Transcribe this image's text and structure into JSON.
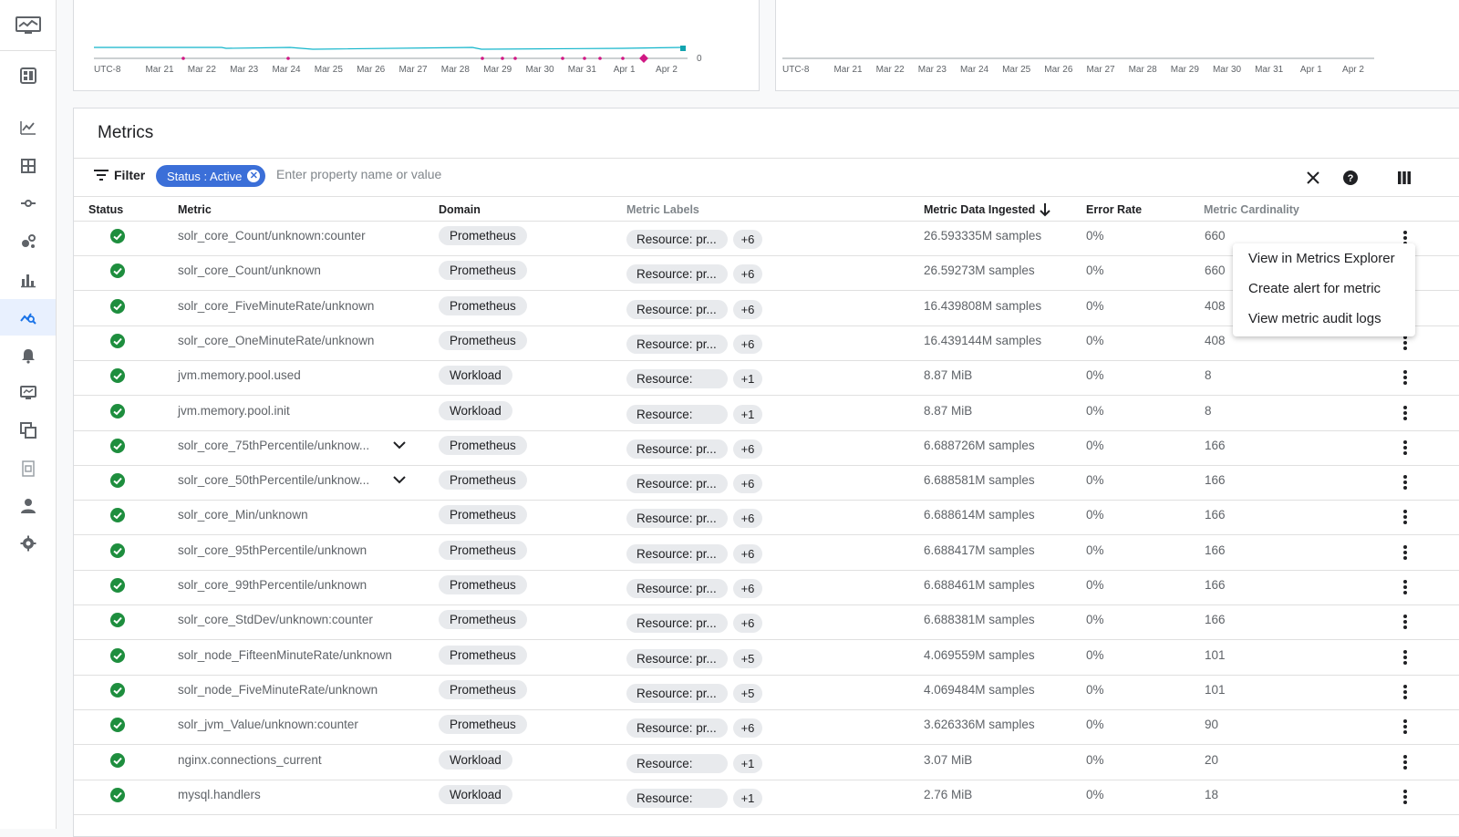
{
  "sidebar": {
    "items": [
      {
        "icon": "dashboard-icon"
      },
      {
        "icon": "line-chart-icon"
      },
      {
        "icon": "grid-icon"
      },
      {
        "icon": "trace-icon"
      },
      {
        "icon": "services-icon"
      },
      {
        "icon": "bar-chart-icon"
      },
      {
        "icon": "metrics-management-icon"
      },
      {
        "icon": "bell-icon"
      },
      {
        "icon": "monitor-icon"
      },
      {
        "icon": "copy-icon"
      },
      {
        "icon": "doc-icon"
      },
      {
        "icon": "person-icon"
      },
      {
        "icon": "gear-icon"
      }
    ]
  },
  "charts": {
    "tz_label": "UTC-8",
    "x_ticks": [
      "Mar 21",
      "Mar 22",
      "Mar 23",
      "Mar 24",
      "Mar 25",
      "Mar 26",
      "Mar 27",
      "Mar 28",
      "Mar 29",
      "Mar 30",
      "Mar 31",
      "Apr 1",
      "Apr 2"
    ],
    "y_zero_label": "0"
  },
  "metrics": {
    "title": "Metrics",
    "filter_label": "Filter",
    "active_filter_chip": "Status : Active",
    "search_placeholder": "Enter property name or value",
    "columns": {
      "status": "Status",
      "metric": "Metric",
      "domain": "Domain",
      "labels": "Metric Labels",
      "ingested": "Metric Data Ingested",
      "error_rate": "Error Rate",
      "cardinality": "Metric Cardinality"
    },
    "rows": [
      {
        "metric": "solr_core_Count/unknown:counter",
        "domain": "Prometheus",
        "label": "Resource: pr...",
        "count": "+6",
        "ingested": "26.593335M samples",
        "error": "0%",
        "card": "660"
      },
      {
        "metric": "solr_core_Count/unknown",
        "domain": "Prometheus",
        "label": "Resource: pr...",
        "count": "+6",
        "ingested": "26.59273M samples",
        "error": "0%",
        "card": "660"
      },
      {
        "metric": "solr_core_FiveMinuteRate/unknown",
        "domain": "Prometheus",
        "label": "Resource: pr...",
        "count": "+6",
        "ingested": "16.439808M samples",
        "error": "0%",
        "card": "408"
      },
      {
        "metric": "solr_core_OneMinuteRate/unknown",
        "domain": "Prometheus",
        "label": "Resource: pr...",
        "count": "+6",
        "ingested": "16.439144M samples",
        "error": "0%",
        "card": "408"
      },
      {
        "metric": "jvm.memory.pool.used",
        "domain": "Workload",
        "label": "Resource: gc...",
        "count": "+1",
        "ingested": "8.87 MiB",
        "error": "0%",
        "card": "8"
      },
      {
        "metric": "jvm.memory.pool.init",
        "domain": "Workload",
        "label": "Resource: gc...",
        "count": "+1",
        "ingested": "8.87 MiB",
        "error": "0%",
        "card": "8"
      },
      {
        "metric": "solr_core_75thPercentile/unknow...",
        "domain": "Prometheus",
        "label": "Resource: pr...",
        "count": "+6",
        "ingested": "6.688726M samples",
        "error": "0%",
        "card": "166"
      },
      {
        "metric": "solr_core_50thPercentile/unknow...",
        "domain": "Prometheus",
        "label": "Resource: pr...",
        "count": "+6",
        "ingested": "6.688581M samples",
        "error": "0%",
        "card": "166"
      },
      {
        "metric": "solr_core_Min/unknown",
        "domain": "Prometheus",
        "label": "Resource: pr...",
        "count": "+6",
        "ingested": "6.688614M samples",
        "error": "0%",
        "card": "166"
      },
      {
        "metric": "solr_core_95thPercentile/unknown",
        "domain": "Prometheus",
        "label": "Resource: pr...",
        "count": "+6",
        "ingested": "6.688417M samples",
        "error": "0%",
        "card": "166"
      },
      {
        "metric": "solr_core_99thPercentile/unknown",
        "domain": "Prometheus",
        "label": "Resource: pr...",
        "count": "+6",
        "ingested": "6.688461M samples",
        "error": "0%",
        "card": "166"
      },
      {
        "metric": "solr_core_StdDev/unknown:counter",
        "domain": "Prometheus",
        "label": "Resource: pr...",
        "count": "+6",
        "ingested": "6.688381M samples",
        "error": "0%",
        "card": "166"
      },
      {
        "metric": "solr_node_FifteenMinuteRate/unknown",
        "domain": "Prometheus",
        "label": "Resource: pr...",
        "count": "+5",
        "ingested": "4.069559M samples",
        "error": "0%",
        "card": "101"
      },
      {
        "metric": "solr_node_FiveMinuteRate/unknown",
        "domain": "Prometheus",
        "label": "Resource: pr...",
        "count": "+5",
        "ingested": "4.069484M samples",
        "error": "0%",
        "card": "101"
      },
      {
        "metric": "solr_jvm_Value/unknown:counter",
        "domain": "Prometheus",
        "label": "Resource: pr...",
        "count": "+6",
        "ingested": "3.626336M samples",
        "error": "0%",
        "card": "90"
      },
      {
        "metric": "nginx.connections_current",
        "domain": "Workload",
        "label": "Resource: gc...",
        "count": "+1",
        "ingested": "3.07 MiB",
        "error": "0%",
        "card": "20"
      },
      {
        "metric": "mysql.handlers",
        "domain": "Workload",
        "label": "Resource: gc...",
        "count": "+1",
        "ingested": "2.76 MiB",
        "error": "0%",
        "card": "18"
      }
    ]
  },
  "context_menu": {
    "items": [
      "View in Metrics Explorer",
      "Create alert for metric",
      "View metric audit logs"
    ]
  },
  "colors": {
    "accent": "#3b6fd8",
    "status_ok": "#1e8e3e",
    "chart_line": "#12b5cb",
    "chart_marker": "#d01884"
  }
}
